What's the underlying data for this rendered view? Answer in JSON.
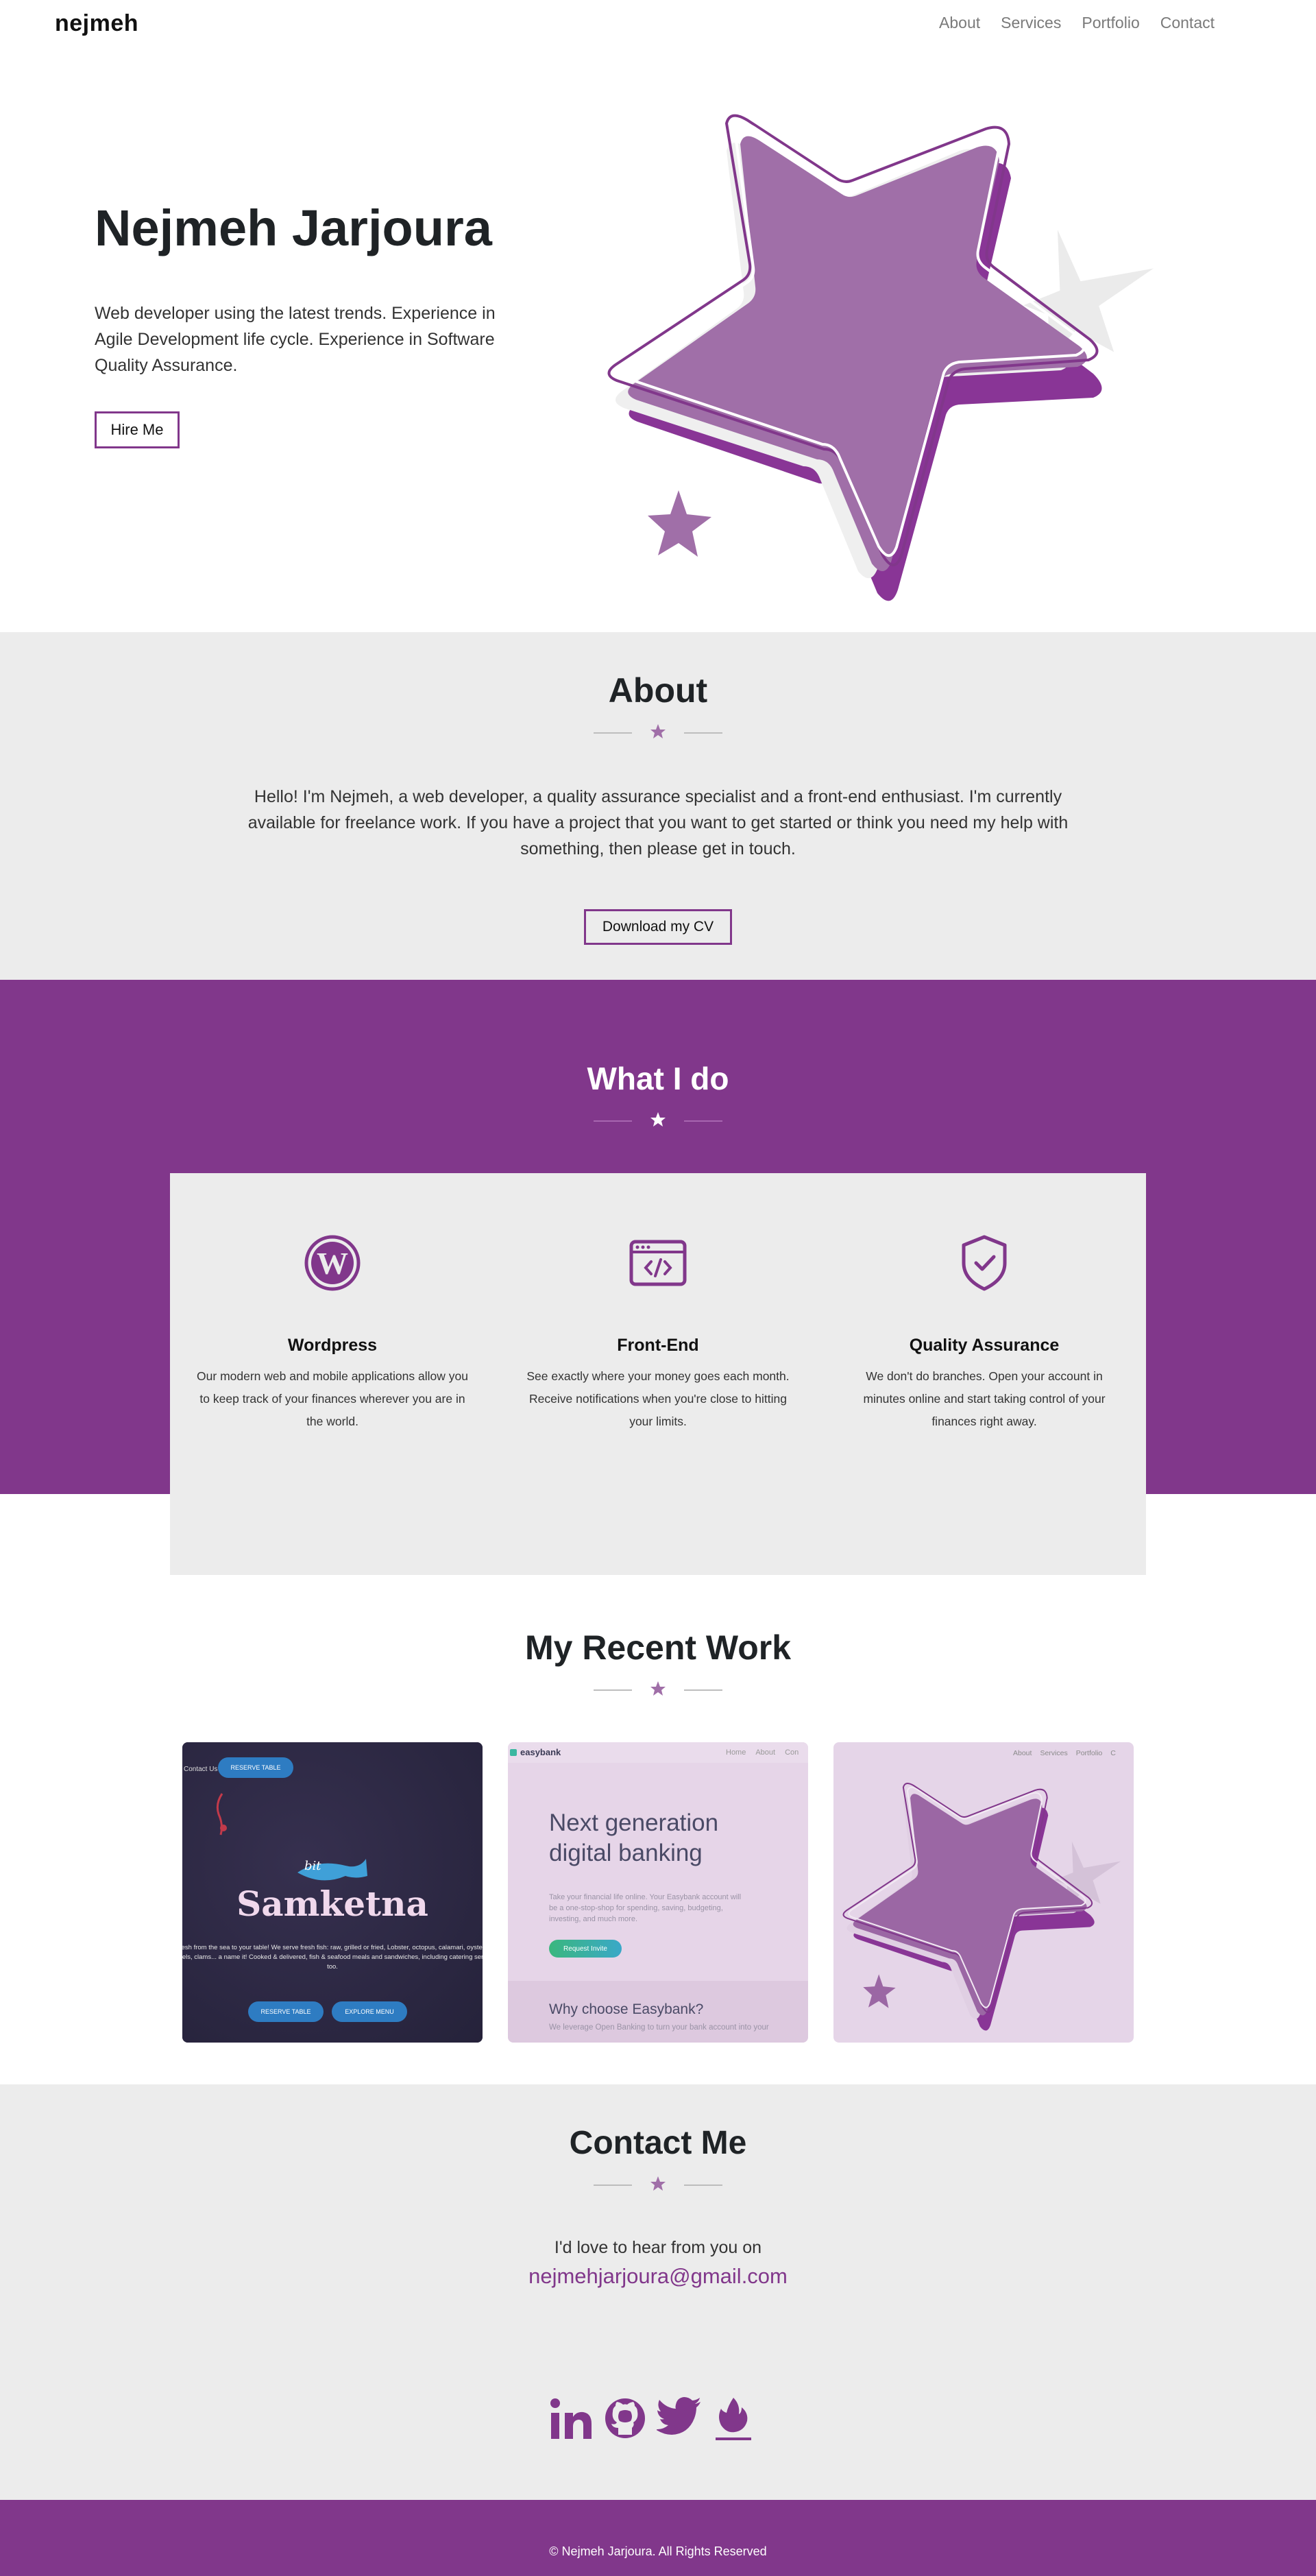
{
  "nav": {
    "brand": "nejmeh",
    "links": [
      "About",
      "Services",
      "Portfolio",
      "Contact"
    ]
  },
  "hero": {
    "title": "Nejmeh Jarjoura",
    "description": "Web developer using the latest trends. Experience in Agile Development life cycle. Experience in Software Quality Assurance.",
    "button": "Hire Me"
  },
  "about": {
    "title": "About",
    "text": "Hello! I'm Nejmeh, a web developer, a quality assurance specialist and a front-end enthusiast. I'm currently available for freelance work. If you have a project that you want to get started or think you need my help with something, then please get in touch.",
    "button": "Download my CV"
  },
  "services": {
    "title": "What I do",
    "items": [
      {
        "icon": "wordpress-icon",
        "title": "Wordpress",
        "text": "Our modern web and mobile applications allow you to keep track of your finances wherever you are in the world."
      },
      {
        "icon": "code-window-icon",
        "title": "Front-End",
        "text": "See exactly where your money goes each month. Receive notifications when you're close to hitting your limits."
      },
      {
        "icon": "shield-check-icon",
        "title": "Quality Assurance",
        "text": "We don't do branches. Open your account in minutes online and start taking control of your finances right away."
      }
    ]
  },
  "work": {
    "title": "My Recent Work",
    "items": [
      {
        "name": "samketna",
        "nav_text": "Contact Us",
        "top_button": "RESERVE TABLE",
        "logo_text": "Samketna",
        "desc": "Fresh from the sea to your table! We serve fresh fish: raw, grilled or fried, Lobster, octopus, calamari, oysters, mussels, clams... a name it! Cooked & delivered, fish & seafood meals and sandwiches, including catering services too.",
        "buttons": [
          "RESERVE TABLE",
          "EXPLORE MENU"
        ]
      },
      {
        "name": "easybank",
        "brand": "easybank",
        "nav": [
          "Home",
          "About",
          "Con"
        ],
        "headline": "Next generation digital banking",
        "body": "Take your financial life online. Your Easybank account will be a one-stop-shop for spending, saving, budgeting, investing, and much more.",
        "button": "Request Invite",
        "sub": "Why choose Easybank?",
        "sub_text": "We leverage Open Banking to turn your bank account into your"
      },
      {
        "name": "portfolio",
        "nav": [
          "About",
          "Services",
          "Portfolio",
          "C"
        ]
      }
    ]
  },
  "contact": {
    "title": "Contact Me",
    "text": "I'd love to hear from you on",
    "email": "nejmehjarjoura@gmail.com",
    "socials": [
      "linkedin-icon",
      "github-icon",
      "twitter-icon",
      "codepen-flame-icon"
    ]
  },
  "footer": {
    "text": "© Nejmeh Jarjoura. All Rights Reserved"
  },
  "colors": {
    "accent": "#81378b",
    "star": "#a06fa8",
    "light_bg": "#ececec",
    "footer_text": "#ffffff"
  }
}
